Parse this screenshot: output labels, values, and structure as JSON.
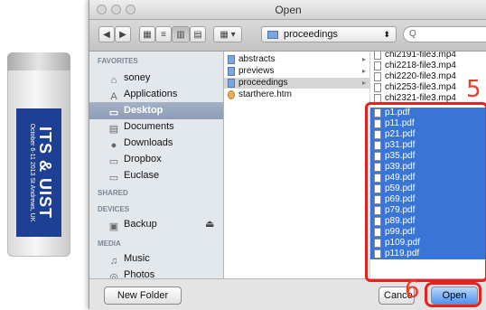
{
  "usb": {
    "title": "ITS & UIST",
    "subtitle": "October 6-11 2013 St Andrews, UK"
  },
  "window": {
    "title": "Open"
  },
  "toolbar": {
    "path_label": "proceedings",
    "search_placeholder": "Q"
  },
  "sidebar": {
    "sections": [
      {
        "header": "FAVORITES",
        "items": [
          {
            "label": "soney",
            "icon": "home-icon"
          },
          {
            "label": "Applications",
            "icon": "applications-icon"
          },
          {
            "label": "Desktop",
            "icon": "desktop-icon",
            "selected": true
          },
          {
            "label": "Documents",
            "icon": "documents-icon"
          },
          {
            "label": "Downloads",
            "icon": "downloads-icon"
          },
          {
            "label": "Dropbox",
            "icon": "folder-icon"
          },
          {
            "label": "Euclase",
            "icon": "folder-icon"
          }
        ]
      },
      {
        "header": "SHARED",
        "items": []
      },
      {
        "header": "DEVICES",
        "items": [
          {
            "label": "Backup",
            "icon": "drive-icon",
            "eject": "⏏"
          }
        ]
      },
      {
        "header": "MEDIA",
        "items": [
          {
            "label": "Music",
            "icon": "music-icon"
          },
          {
            "label": "Photos",
            "icon": "camera-icon"
          }
        ]
      }
    ]
  },
  "columns": {
    "col1": [
      {
        "label": "abstracts",
        "folder": true
      },
      {
        "label": "previews",
        "folder": true
      },
      {
        "label": "proceedings",
        "folder": true,
        "selected": true
      },
      {
        "label": "starthere.htm",
        "folder": false
      }
    ],
    "col2_top": [
      {
        "label": "chi2191-file3.mp4"
      },
      {
        "label": "chi2218-file3.mp4"
      },
      {
        "label": "chi2220-file3.mp4"
      },
      {
        "label": "chi2253-file3.mp4"
      },
      {
        "label": "chi2321-file3.mp4"
      }
    ],
    "col2_selected": [
      {
        "label": "p1.pdf"
      },
      {
        "label": "p11.pdf"
      },
      {
        "label": "p21.pdf"
      },
      {
        "label": "p31.pdf"
      },
      {
        "label": "p35.pdf"
      },
      {
        "label": "p39.pdf"
      },
      {
        "label": "p49.pdf"
      },
      {
        "label": "p59.pdf"
      },
      {
        "label": "p69.pdf"
      },
      {
        "label": "p79.pdf"
      },
      {
        "label": "p89.pdf"
      },
      {
        "label": "p99.pdf"
      },
      {
        "label": "p109.pdf"
      },
      {
        "label": "p119.pdf"
      }
    ]
  },
  "bottom": {
    "new_folder": "New Folder",
    "cancel": "Cance",
    "open": "Open"
  },
  "annotations": {
    "five": "5",
    "six": "6"
  }
}
